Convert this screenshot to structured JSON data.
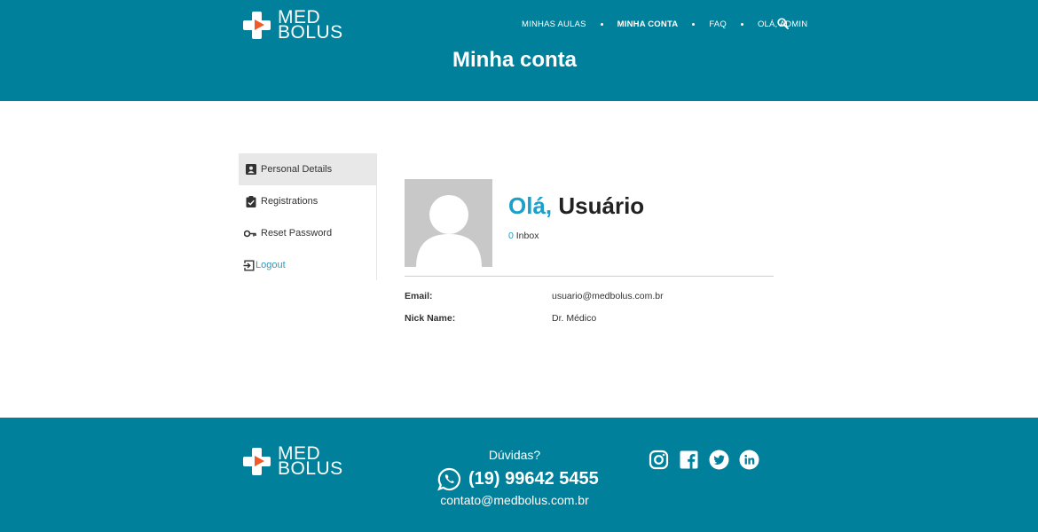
{
  "brand": {
    "line1": "MED",
    "line2": "BOLUS"
  },
  "nav": {
    "items": [
      {
        "label": "MINHAS AULAS",
        "active": false
      },
      {
        "label": "MINHA CONTA",
        "active": true
      },
      {
        "label": "FAQ",
        "active": false
      },
      {
        "label": "OLÁ, ADMIN",
        "active": false
      }
    ],
    "search_icon": "search-icon"
  },
  "page": {
    "title": "Minha conta"
  },
  "sidebar": {
    "items": [
      {
        "label": "Personal Details",
        "icon": "person-card-icon",
        "active": true
      },
      {
        "label": "Registrations",
        "icon": "clipboard-check-icon",
        "active": false
      },
      {
        "label": "Reset Password",
        "icon": "key-icon",
        "active": false
      },
      {
        "label": "Logout",
        "icon": "logout-icon",
        "active": false
      }
    ]
  },
  "profile": {
    "greeting_hi": "Olá,",
    "greeting_name": "Usuário",
    "inbox_count": "0",
    "inbox_label": "Inbox",
    "fields": [
      {
        "label": "Email:",
        "value": "usuario@medbolus.com.br"
      },
      {
        "label": "Nick Name:",
        "value": "Dr. Médico"
      }
    ]
  },
  "footer": {
    "question": "Dúvidas?",
    "phone": "(19) 99642 5455",
    "email": "contato@medbolus.com.br",
    "social": [
      "instagram-icon",
      "facebook-icon",
      "twitter-icon",
      "linkedin-icon"
    ]
  },
  "colors": {
    "brand": "#00809a",
    "accent": "#1aa0c9",
    "logo_play": "#f05a28"
  }
}
